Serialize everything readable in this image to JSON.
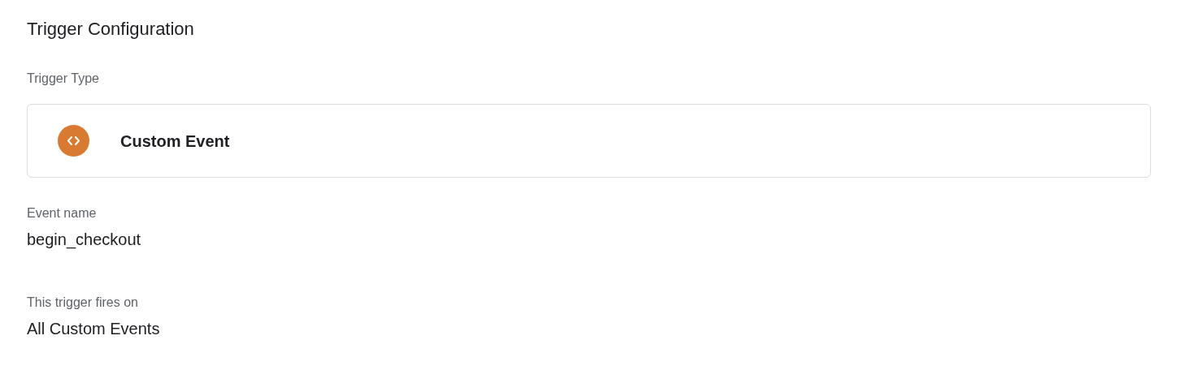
{
  "title": "Trigger Configuration",
  "trigger_type": {
    "label": "Trigger Type",
    "value": "Custom Event"
  },
  "fields": [
    {
      "label": "Event name",
      "value": "begin_checkout"
    },
    {
      "label": "This trigger fires on",
      "value": "All Custom Events"
    }
  ]
}
